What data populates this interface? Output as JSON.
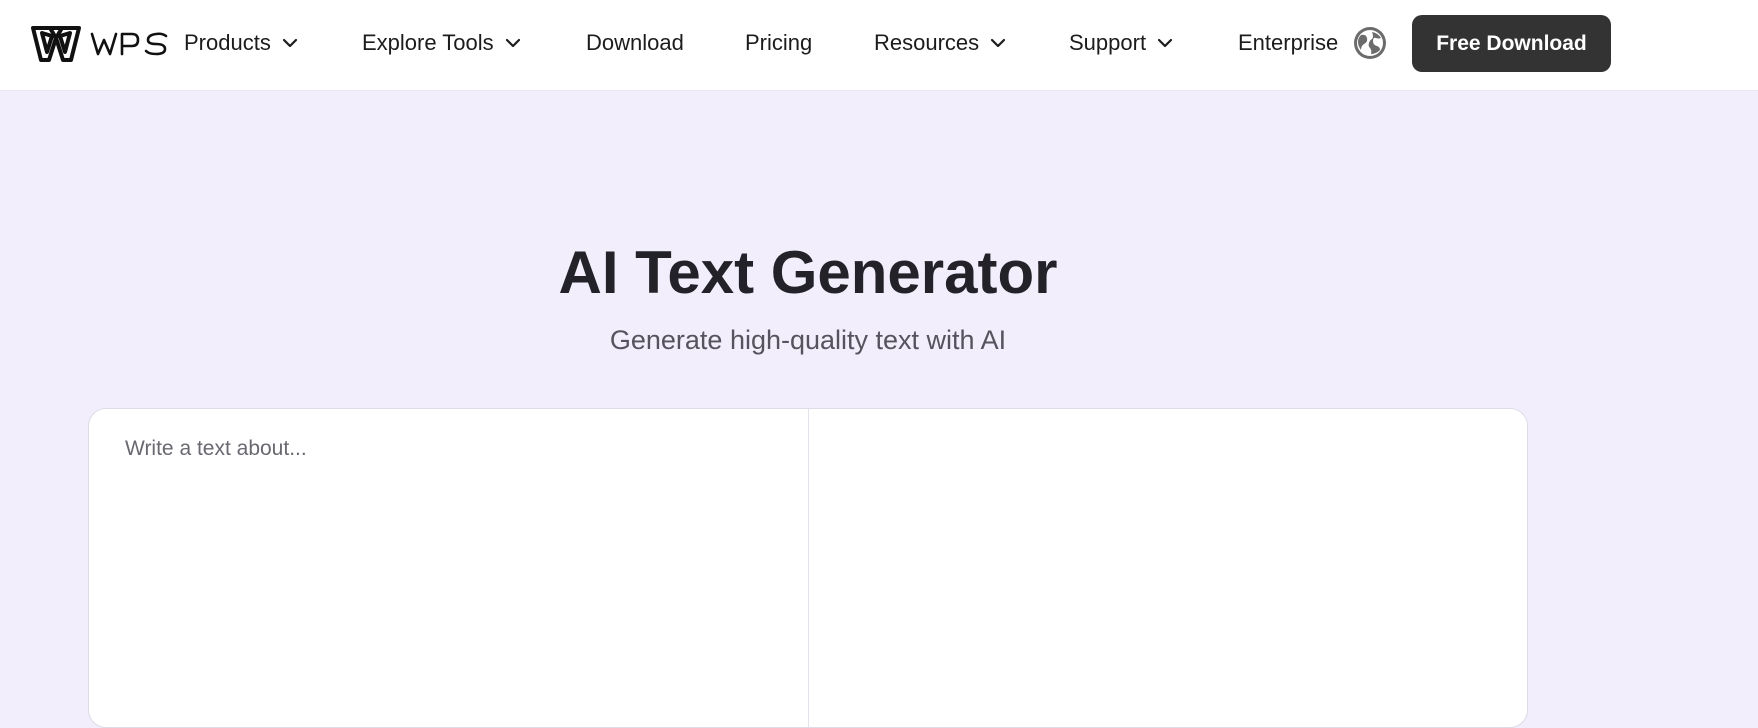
{
  "brand": {
    "name": "WPS"
  },
  "nav": {
    "items": [
      {
        "label": "Products",
        "has_dropdown": true
      },
      {
        "label": "Explore Tools",
        "has_dropdown": true
      },
      {
        "label": "Download",
        "has_dropdown": false
      },
      {
        "label": "Pricing",
        "has_dropdown": false
      },
      {
        "label": "Resources",
        "has_dropdown": true
      },
      {
        "label": "Support",
        "has_dropdown": true
      },
      {
        "label": "Enterprise",
        "has_dropdown": false
      }
    ],
    "language_icon": "globe-icon",
    "cta_label": "Free Download"
  },
  "hero": {
    "title": "AI Text Generator",
    "subtitle": "Generate high-quality text with AI"
  },
  "editor": {
    "input_placeholder": "Write a text about...",
    "input_value": "",
    "output_text": ""
  },
  "colors": {
    "page_background": "#f2eefc",
    "cta_background": "#333333",
    "title_text": "#232228"
  }
}
